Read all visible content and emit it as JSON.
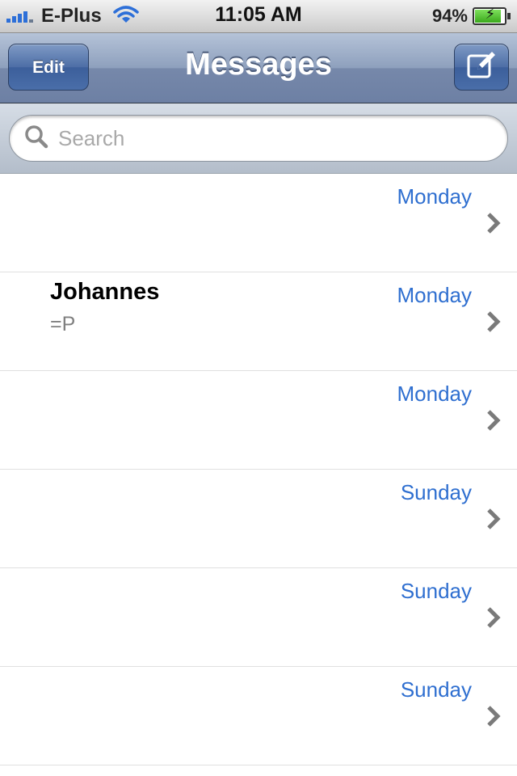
{
  "status_bar": {
    "carrier": "E-Plus",
    "time": "11:05 AM",
    "battery_percent": "94%",
    "battery_level": 0.94,
    "signal_icon": "signal-bars-icon",
    "wifi_icon": "wifi-icon",
    "charging_icon": "lightning-icon"
  },
  "nav": {
    "edit_label": "Edit",
    "title": "Messages",
    "compose_icon": "compose-icon"
  },
  "search": {
    "placeholder": "Search",
    "icon": "search-icon"
  },
  "conversations": [
    {
      "name": "",
      "preview": "",
      "date": "Monday"
    },
    {
      "name": "Johannes",
      "preview": "=P",
      "date": "Monday"
    },
    {
      "name": "",
      "preview": "",
      "date": "Monday"
    },
    {
      "name": "",
      "preview": "",
      "date": "Sunday"
    },
    {
      "name": "",
      "preview": "",
      "date": "Sunday"
    },
    {
      "name": "",
      "preview": "",
      "date": "Sunday"
    }
  ],
  "colors": {
    "accent_date": "#2f6fd0",
    "nav_bar": "#7688aa",
    "signal_blue": "#2d6fd8",
    "battery_green": "#3aa81b"
  }
}
